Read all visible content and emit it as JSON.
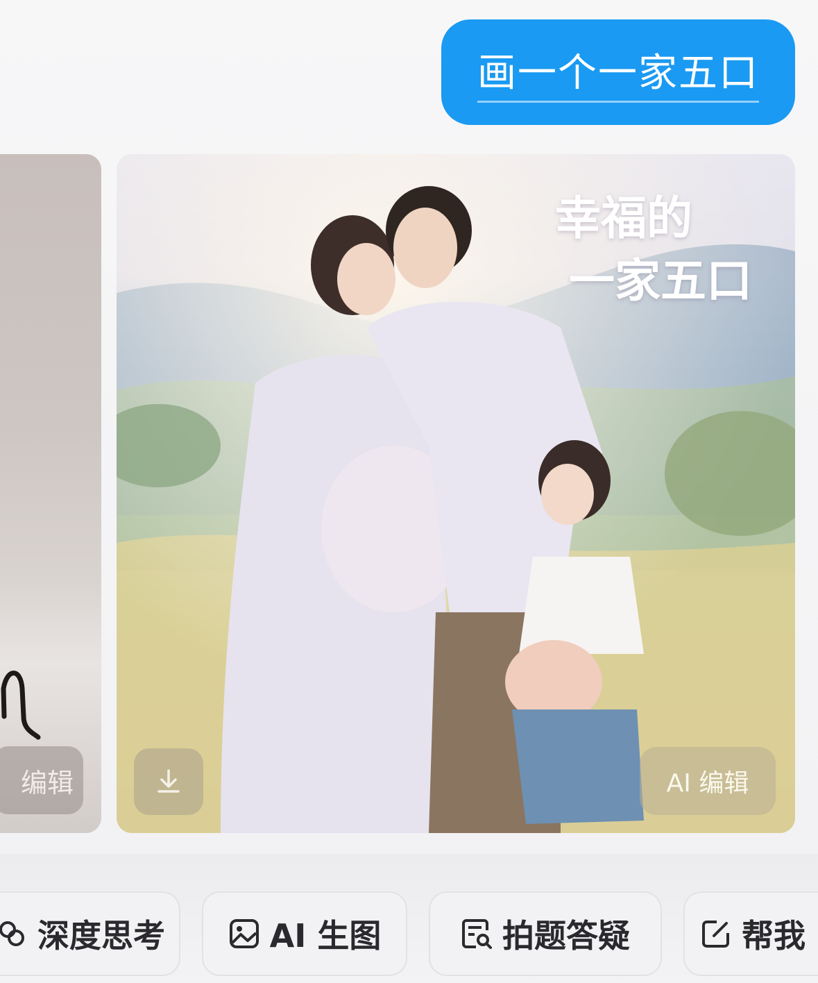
{
  "chat": {
    "user_message": "画一个一家五口"
  },
  "left_card": {
    "edit_label": "编辑"
  },
  "image_card": {
    "overlay_title_line1": "幸福的",
    "overlay_title_line2": "一家五口",
    "download_icon": "download-icon",
    "ai_edit_label": "AI 编辑"
  },
  "quick_actions": [
    {
      "label": "深度思考",
      "icon": "deep-think-icon"
    },
    {
      "label": "AI 生图",
      "icon": "image-icon"
    },
    {
      "label": "拍题答疑",
      "icon": "search-doc-icon"
    },
    {
      "label": "帮我",
      "icon": "edit-icon"
    }
  ],
  "colors": {
    "bubble": "#1a9af2",
    "page_bg": "#f4f4f6"
  }
}
